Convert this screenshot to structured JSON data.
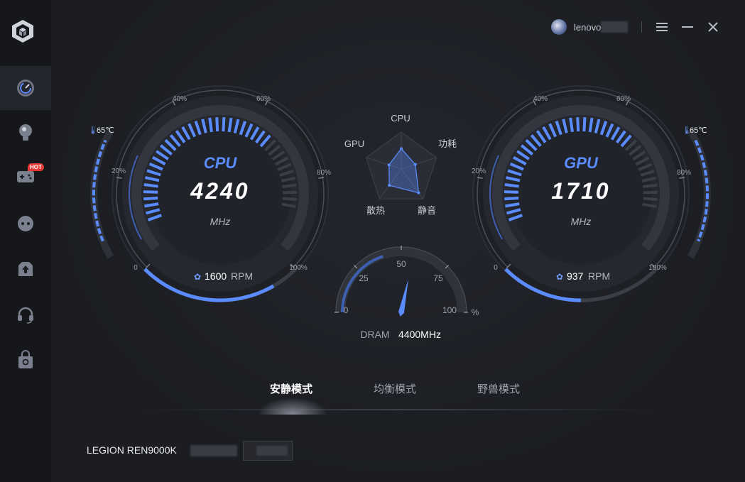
{
  "sidebar": {
    "hot_badge": "HOT",
    "items": [
      {
        "icon": "dashboard-gauge-icon",
        "active": true
      },
      {
        "icon": "lightbulb-icon",
        "active": false
      },
      {
        "icon": "gamepad-icon",
        "active": false
      },
      {
        "icon": "chat-bubble-icon",
        "active": false
      },
      {
        "icon": "upload-box-icon",
        "active": false
      },
      {
        "icon": "headset-icon",
        "active": false
      },
      {
        "icon": "shopping-bag-icon",
        "active": false
      }
    ]
  },
  "header": {
    "username": "lenovo"
  },
  "cpu": {
    "label": "CPU",
    "value": "4240",
    "unit": "MHz",
    "fan_value": "1600",
    "fan_unit": "RPM",
    "temp": "65℃",
    "load_fraction": 0.72
  },
  "gpu": {
    "label": "GPU",
    "value": "1710",
    "unit": "MHz",
    "fan_value": "937",
    "fan_unit": "RPM",
    "temp": "65℃",
    "load_fraction": 0.72
  },
  "gauge_ticks": [
    "0",
    "20%",
    "40%",
    "60%",
    "80%",
    "100%"
  ],
  "radar": {
    "labels": [
      "CPU",
      "功耗",
      "静音",
      "散热",
      "GPU"
    ],
    "values": [
      0.55,
      0.4,
      0.8,
      0.55,
      0.35
    ]
  },
  "dram": {
    "label": "DRAM",
    "value": "4400MHz",
    "ticks": [
      "0",
      "25",
      "50",
      "75",
      "100"
    ],
    "unit": "%",
    "percent": 40
  },
  "modes": {
    "items": [
      "安静模式",
      "均衡模式",
      "野兽模式"
    ],
    "active_index": 0
  },
  "footer": {
    "model": "LEGION REN9000K"
  },
  "colors": {
    "accent": "#5b8cff",
    "accent_dim": "#3e5fb0",
    "temp_icon": "#6f9bff"
  }
}
